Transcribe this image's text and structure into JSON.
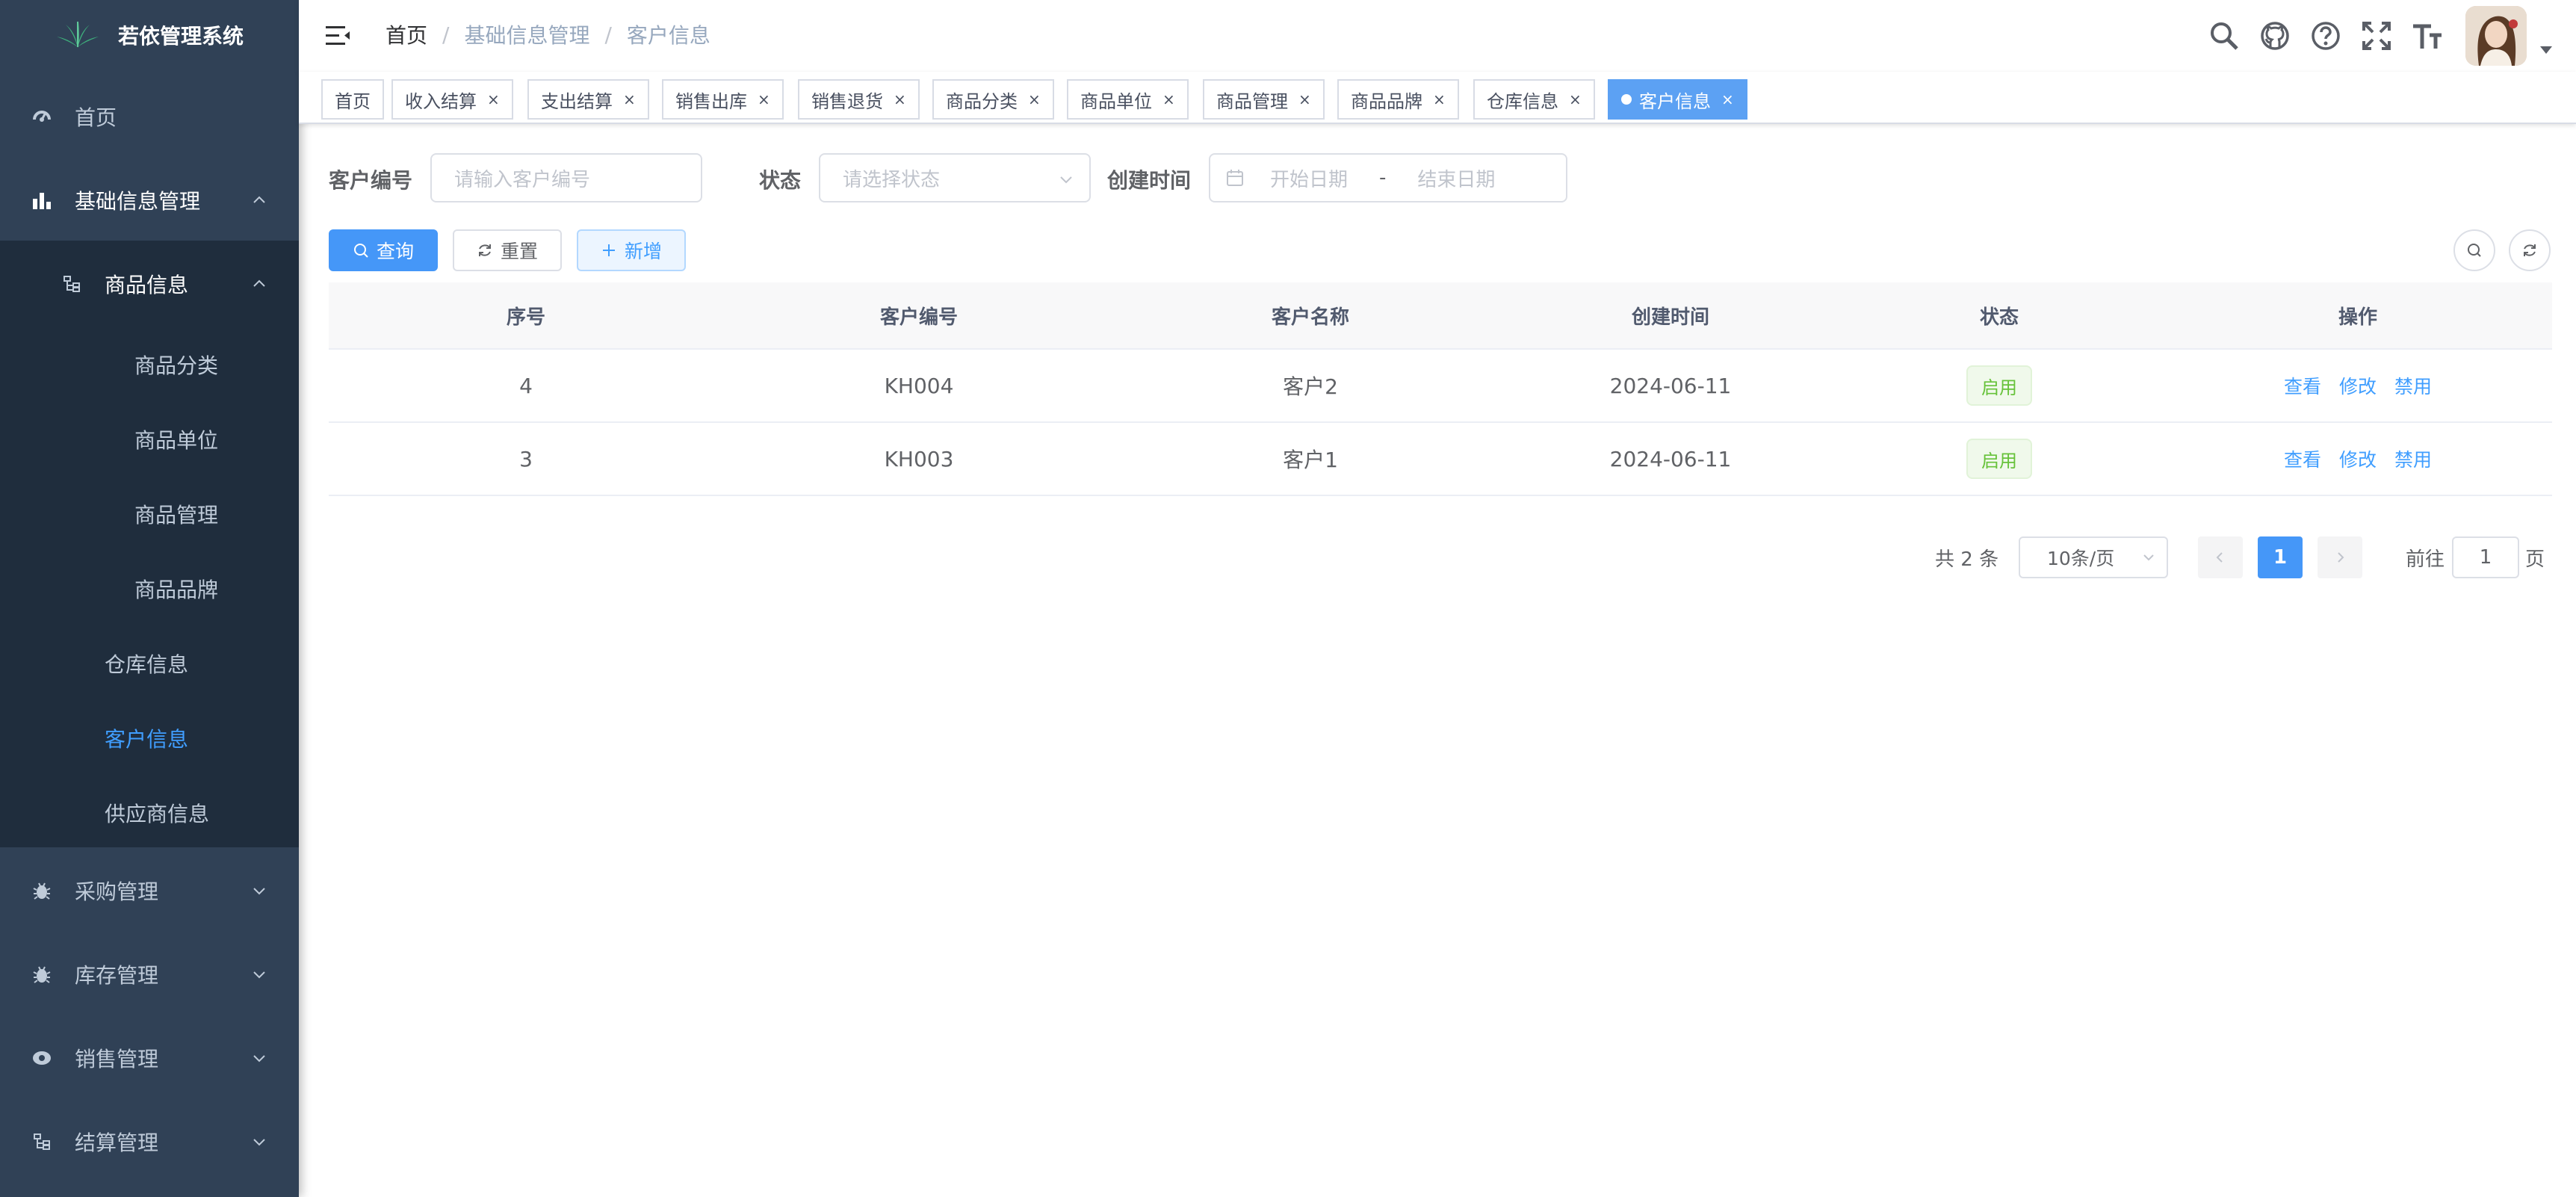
{
  "app": {
    "title": "若依管理系统"
  },
  "sidebar": {
    "items": [
      {
        "label": "首页",
        "icon": "dashboard-icon"
      },
      {
        "label": "基础信息管理",
        "icon": "chart-icon",
        "expanded": true
      },
      {
        "label": "商品信息",
        "icon": "tree-icon",
        "expanded": true
      },
      {
        "label": "商品分类"
      },
      {
        "label": "商品单位"
      },
      {
        "label": "商品管理"
      },
      {
        "label": "商品品牌"
      },
      {
        "label": "仓库信息"
      },
      {
        "label": "客户信息",
        "active": true
      },
      {
        "label": "供应商信息"
      },
      {
        "label": "采购管理",
        "icon": "bug-icon"
      },
      {
        "label": "库存管理",
        "icon": "bug-icon"
      },
      {
        "label": "销售管理",
        "icon": "eye-icon"
      },
      {
        "label": "结算管理",
        "icon": "tree-icon"
      }
    ]
  },
  "breadcrumb": {
    "home": "首页",
    "level1": "基础信息管理",
    "current": "客户信息",
    "separator": "/"
  },
  "tags": [
    {
      "label": "首页"
    },
    {
      "label": "收入结算"
    },
    {
      "label": "支出结算"
    },
    {
      "label": "销售出库"
    },
    {
      "label": "销售退货"
    },
    {
      "label": "商品分类"
    },
    {
      "label": "商品单位"
    },
    {
      "label": "商品管理"
    },
    {
      "label": "商品品牌"
    },
    {
      "label": "仓库信息"
    },
    {
      "label": "客户信息",
      "active": true
    }
  ],
  "filter": {
    "code_label": "客户编号",
    "code_placeholder": "请输入客户编号",
    "status_label": "状态",
    "status_placeholder": "请选择状态",
    "date_label": "创建时间",
    "start_placeholder": "开始日期",
    "end_placeholder": "结束日期",
    "range_sep": "-"
  },
  "toolbar": {
    "search": "查询",
    "reset": "重置",
    "add": "新增"
  },
  "table": {
    "headers": [
      "序号",
      "客户编号",
      "客户名称",
      "创建时间",
      "状态",
      "操作"
    ],
    "rows": [
      {
        "index": "4",
        "code": "KH004",
        "name": "客户2",
        "created": "2024-06-11",
        "status": "启用"
      },
      {
        "index": "3",
        "code": "KH003",
        "name": "客户1",
        "created": "2024-06-11",
        "status": "启用"
      }
    ],
    "actions": {
      "view": "查看",
      "edit": "修改",
      "disable": "禁用"
    }
  },
  "pagination": {
    "total": "共 2 条",
    "page_size": "10条/页",
    "current_page": "1",
    "goto_label": "前往",
    "goto_value": "1",
    "page_suffix": "页"
  },
  "colors": {
    "sidebar_bg": "#304156",
    "submenu_bg": "#1f2d3d",
    "primary": "#409eff",
    "success": "#67c23a"
  }
}
